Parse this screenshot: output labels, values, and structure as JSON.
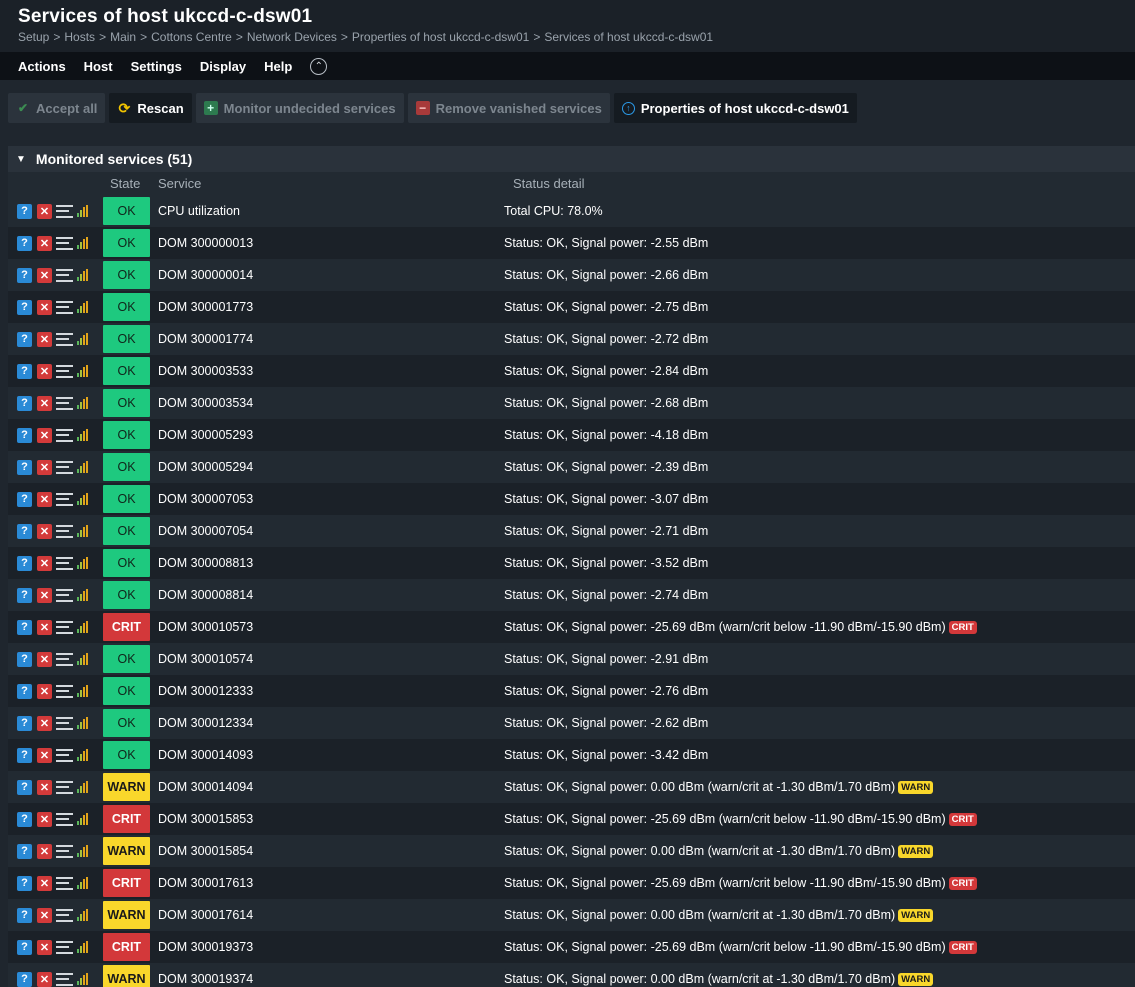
{
  "header": {
    "title": "Services of host ukccd-c-dsw01",
    "breadcrumb": [
      "Setup",
      "Hosts",
      "Main",
      "Cottons Centre",
      "Network Devices",
      "Properties of host ukccd-c-dsw01",
      "Services of host ukccd-c-dsw01"
    ],
    "separator": ">"
  },
  "menu": [
    "Actions",
    "Host",
    "Settings",
    "Display",
    "Help"
  ],
  "toolbar": {
    "accept_all": "Accept all",
    "rescan": "Rescan",
    "monitor_undecided": "Monitor undecided services",
    "remove_vanished": "Remove vanished services",
    "properties": "Properties of host ukccd-c-dsw01"
  },
  "section": {
    "title": "Monitored services (51)",
    "columns": {
      "state": "State",
      "service": "Service",
      "detail": "Status detail"
    }
  },
  "rows": [
    {
      "state": "OK",
      "service": "CPU utilization",
      "detail": "Total CPU: 78.0%",
      "badge": ""
    },
    {
      "state": "OK",
      "service": "DOM 300000013",
      "detail": "Status: OK, Signal power: -2.55 dBm",
      "badge": ""
    },
    {
      "state": "OK",
      "service": "DOM 300000014",
      "detail": "Status: OK, Signal power: -2.66 dBm",
      "badge": ""
    },
    {
      "state": "OK",
      "service": "DOM 300001773",
      "detail": "Status: OK, Signal power: -2.75 dBm",
      "badge": ""
    },
    {
      "state": "OK",
      "service": "DOM 300001774",
      "detail": "Status: OK, Signal power: -2.72 dBm",
      "badge": ""
    },
    {
      "state": "OK",
      "service": "DOM 300003533",
      "detail": "Status: OK, Signal power: -2.84 dBm",
      "badge": ""
    },
    {
      "state": "OK",
      "service": "DOM 300003534",
      "detail": "Status: OK, Signal power: -2.68 dBm",
      "badge": ""
    },
    {
      "state": "OK",
      "service": "DOM 300005293",
      "detail": "Status: OK, Signal power: -4.18 dBm",
      "badge": ""
    },
    {
      "state": "OK",
      "service": "DOM 300005294",
      "detail": "Status: OK, Signal power: -2.39 dBm",
      "badge": ""
    },
    {
      "state": "OK",
      "service": "DOM 300007053",
      "detail": "Status: OK, Signal power: -3.07 dBm",
      "badge": ""
    },
    {
      "state": "OK",
      "service": "DOM 300007054",
      "detail": "Status: OK, Signal power: -2.71 dBm",
      "badge": ""
    },
    {
      "state": "OK",
      "service": "DOM 300008813",
      "detail": "Status: OK, Signal power: -3.52 dBm",
      "badge": ""
    },
    {
      "state": "OK",
      "service": "DOM 300008814",
      "detail": "Status: OK, Signal power: -2.74 dBm",
      "badge": ""
    },
    {
      "state": "CRIT",
      "service": "DOM 300010573",
      "detail": "Status: OK, Signal power: -25.69 dBm (warn/crit below -11.90 dBm/-15.90 dBm)",
      "badge": "CRIT"
    },
    {
      "state": "OK",
      "service": "DOM 300010574",
      "detail": "Status: OK, Signal power: -2.91 dBm",
      "badge": ""
    },
    {
      "state": "OK",
      "service": "DOM 300012333",
      "detail": "Status: OK, Signal power: -2.76 dBm",
      "badge": ""
    },
    {
      "state": "OK",
      "service": "DOM 300012334",
      "detail": "Status: OK, Signal power: -2.62 dBm",
      "badge": ""
    },
    {
      "state": "OK",
      "service": "DOM 300014093",
      "detail": "Status: OK, Signal power: -3.42 dBm",
      "badge": ""
    },
    {
      "state": "WARN",
      "service": "DOM 300014094",
      "detail": "Status: OK, Signal power: 0.00 dBm (warn/crit at -1.30 dBm/1.70 dBm)",
      "badge": "WARN"
    },
    {
      "state": "CRIT",
      "service": "DOM 300015853",
      "detail": "Status: OK, Signal power: -25.69 dBm (warn/crit below -11.90 dBm/-15.90 dBm)",
      "badge": "CRIT"
    },
    {
      "state": "WARN",
      "service": "DOM 300015854",
      "detail": "Status: OK, Signal power: 0.00 dBm (warn/crit at -1.30 dBm/1.70 dBm)",
      "badge": "WARN"
    },
    {
      "state": "CRIT",
      "service": "DOM 300017613",
      "detail": "Status: OK, Signal power: -25.69 dBm (warn/crit below -11.90 dBm/-15.90 dBm)",
      "badge": "CRIT"
    },
    {
      "state": "WARN",
      "service": "DOM 300017614",
      "detail": "Status: OK, Signal power: 0.00 dBm (warn/crit at -1.30 dBm/1.70 dBm)",
      "badge": "WARN"
    },
    {
      "state": "CRIT",
      "service": "DOM 300019373",
      "detail": "Status: OK, Signal power: -25.69 dBm (warn/crit below -11.90 dBm/-15.90 dBm)",
      "badge": "CRIT"
    },
    {
      "state": "WARN",
      "service": "DOM 300019374",
      "detail": "Status: OK, Signal power: 0.00 dBm (warn/crit at -1.30 dBm/1.70 dBm)",
      "badge": "WARN"
    }
  ],
  "colors": {
    "ok": "#1ec97f",
    "crit": "#d3383a",
    "warn": "#f9d72b"
  },
  "icons": [
    "help-icon",
    "delete-icon",
    "parameters-icon",
    "graph-icon",
    "check-icon",
    "rescan-icon",
    "plus-icon",
    "minus-icon",
    "info-icon",
    "collapse-icon"
  ]
}
